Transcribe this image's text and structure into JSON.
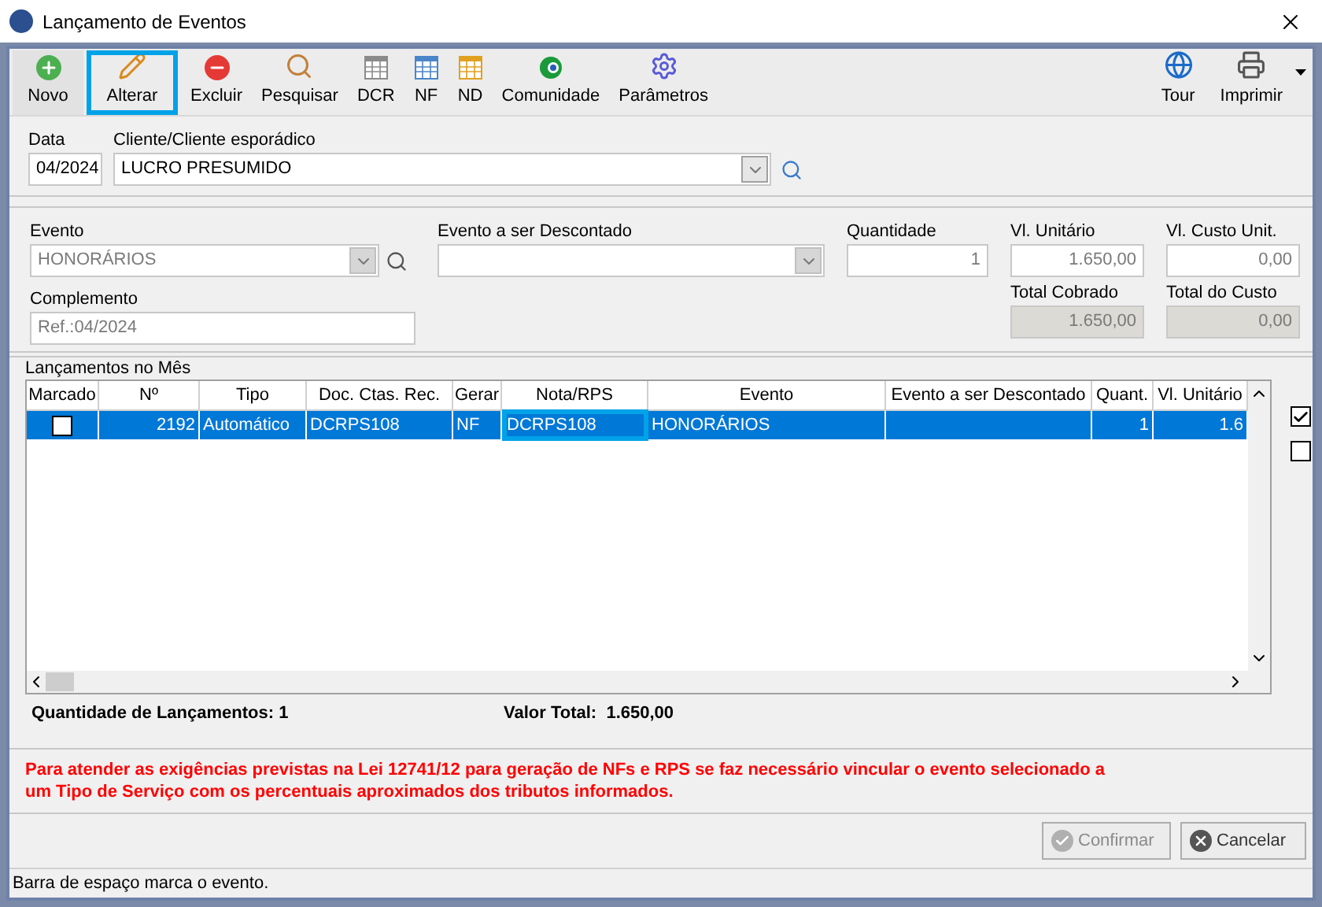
{
  "window": {
    "title": "Lançamento de Eventos"
  },
  "toolbar": [
    {
      "label": "Novo",
      "kind": "add",
      "highlighted": false
    },
    {
      "label": "Alterar",
      "kind": "edit",
      "highlighted": true
    },
    {
      "label": "Excluir",
      "kind": "delete",
      "highlighted": false
    },
    {
      "label": "Pesquisar",
      "kind": "search",
      "highlighted": false
    },
    {
      "label": "DCR",
      "kind": "sheetgray",
      "highlighted": false
    },
    {
      "label": "NF",
      "kind": "sheetblue",
      "highlighted": false
    },
    {
      "label": "ND",
      "kind": "sheetorange",
      "highlighted": false
    },
    {
      "label": "Comunidade",
      "kind": "community",
      "highlighted": false
    },
    {
      "label": "Parâmetros",
      "kind": "gear",
      "highlighted": false
    }
  ],
  "toolbar_right": [
    {
      "label": "Tour",
      "kind": "globe"
    },
    {
      "label": "Imprimir",
      "kind": "printer"
    }
  ],
  "header": {
    "data_label": "Data",
    "data_value": "04/2024",
    "client_label": "Cliente/Cliente esporádico",
    "client_value": "LUCRO PRESUMIDO"
  },
  "event": {
    "evento_label": "Evento",
    "evento_value": "HONORÁRIOS",
    "desc_label": "Evento a ser Descontado",
    "qty_label": "Quantidade",
    "qty_value": "1",
    "unit_label": "Vl. Unitário",
    "unit_value": "1.650,00",
    "cost_label": "Vl. Custo Unit.",
    "cost_value": "0,00",
    "compl_label": "Complemento",
    "compl_value": "Ref.:04/2024",
    "total_label": "Total Cobrado",
    "total_value": "1.650,00",
    "totalcost_label": "Total do Custo",
    "totalcost_value": "0,00"
  },
  "grid": {
    "title": "Lançamentos no Mês",
    "columns": [
      "Marcado",
      "Nº",
      "Tipo",
      "Doc. Ctas. Rec.",
      "Gerar",
      "Nota/RPS",
      "Evento",
      "Evento a ser Descontado",
      "Quant.",
      "Vl. Unitário"
    ],
    "rows": [
      {
        "checked": false,
        "selected": true,
        "cells": [
          {
            "text": "",
            "highlighted": false
          },
          {
            "text": "2192",
            "highlighted": false
          },
          {
            "text": "Automático",
            "highlighted": false
          },
          {
            "text": "DCRPS108",
            "highlighted": false
          },
          {
            "text": "NF",
            "highlighted": false
          },
          {
            "text": "DCRPS108",
            "highlighted": true
          },
          {
            "text": "HONORÁRIOS",
            "highlighted": false
          },
          {
            "text": "",
            "highlighted": false
          },
          {
            "text": "1",
            "highlighted": false
          },
          {
            "text": "1.6",
            "highlighted": false
          }
        ]
      }
    ],
    "mark_all": [
      {
        "checked": true
      },
      {
        "checked": false
      }
    ]
  },
  "totals": {
    "count_label": "Quantidade de Lançamentos:",
    "count_value": "1",
    "total_label": "Valor Total:",
    "total_value": "1.650,00"
  },
  "notice": "Para atender as exigências previstas na Lei 12741/12 para geração de NFs e RPS se faz necessário vincular o evento selecionado a um Tipo de Serviço com os percentuais aproximados dos tributos informados.",
  "buttons": [
    {
      "label": "Confirmar",
      "kind": "confirm",
      "disabled": true
    },
    {
      "label": "Cancelar",
      "kind": "cancel",
      "disabled": false
    }
  ],
  "status_bar": "Barra de espaço marca o evento."
}
